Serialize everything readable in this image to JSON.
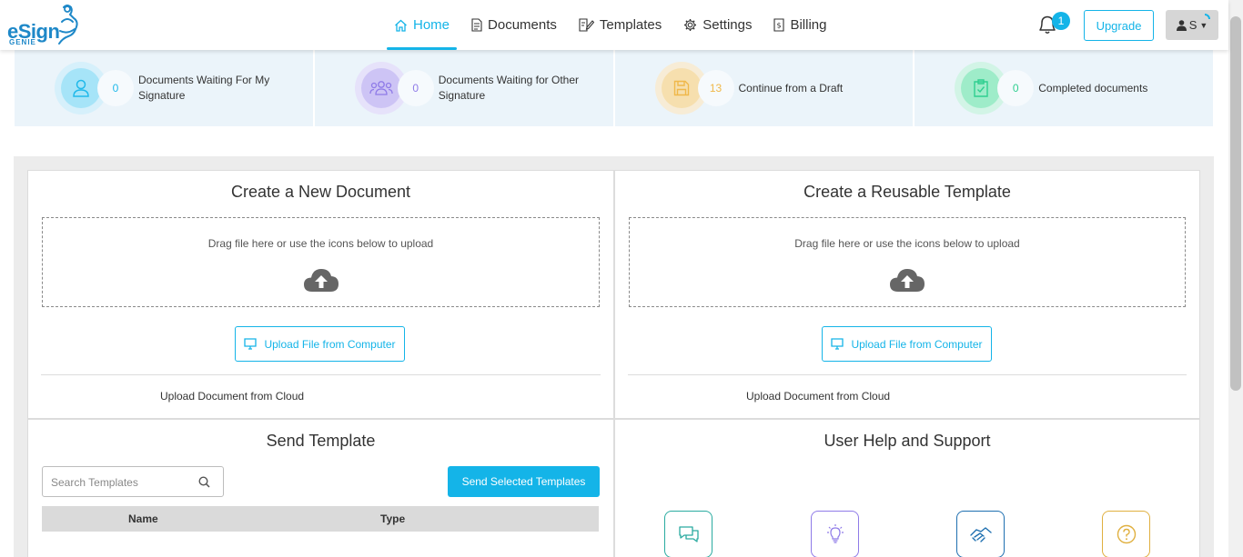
{
  "brand": {
    "name": "eSign",
    "sub": "GENIE"
  },
  "nav": [
    {
      "label": "Home",
      "icon": "home-icon",
      "active": true
    },
    {
      "label": "Documents",
      "icon": "document-icon",
      "active": false
    },
    {
      "label": "Templates",
      "icon": "template-icon",
      "active": false
    },
    {
      "label": "Settings",
      "icon": "gear-icon",
      "active": false
    },
    {
      "label": "Billing",
      "icon": "billing-icon",
      "active": false
    }
  ],
  "header": {
    "notification_count": "1",
    "upgrade_label": "Upgrade",
    "user_initial": "S"
  },
  "stats": [
    {
      "count": "0",
      "label": "Documents Waiting For My Signature",
      "icon": "user-icon",
      "color": "#20b9ea"
    },
    {
      "count": "0",
      "label": "Documents Waiting for Other Signature",
      "icon": "users-icon",
      "color": "#8f7be8"
    },
    {
      "count": "13",
      "label": "Continue from a Draft",
      "icon": "save-icon",
      "color": "#f0b84a"
    },
    {
      "count": "0",
      "label": "Completed documents",
      "icon": "clipboard-check-icon",
      "color": "#2fcf90"
    }
  ],
  "create_document": {
    "title": "Create a New Document",
    "dropzone_text": "Drag file here or use the icons below to upload",
    "upload_label": "Upload File from Computer",
    "cloud_label": "Upload Document from Cloud"
  },
  "create_template": {
    "title": "Create a Reusable Template",
    "dropzone_text": "Drag file here or use the icons below to upload",
    "upload_label": "Upload File from Computer",
    "cloud_label": "Upload Document from Cloud"
  },
  "send_template": {
    "title": "Send Template",
    "search_placeholder": "Search Templates",
    "send_label": "Send Selected Templates",
    "columns": [
      "Name",
      "Type"
    ]
  },
  "help": {
    "title": "User Help and Support",
    "icons": [
      {
        "icon": "chat-icon",
        "color": "#2aaba0"
      },
      {
        "icon": "lightbulb-icon",
        "color": "#8f7be8"
      },
      {
        "icon": "handshake-icon",
        "color": "#1e6fb0"
      },
      {
        "icon": "question-icon",
        "color": "#e0b040"
      }
    ]
  }
}
